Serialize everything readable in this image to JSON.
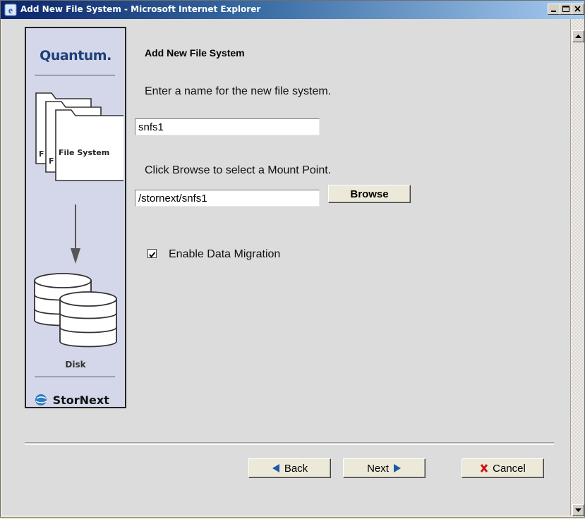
{
  "window": {
    "title": "Add New File System - Microsoft Internet Explorer"
  },
  "sidebar": {
    "brand": "Quantum.",
    "file_system_label": "File System",
    "disk_label": "Disk",
    "product": "StorNext"
  },
  "form": {
    "heading": "Add New File System",
    "name_prompt": "Enter a name for the new file system.",
    "name_value": "snfs1",
    "mount_prompt": "Click Browse to select a Mount Point.",
    "mount_value": "/stornext/snfs1",
    "browse_label": "Browse",
    "migration_label": "Enable Data Migration",
    "migration_checked": true
  },
  "footer": {
    "back_label": "Back",
    "next_label": "Next",
    "cancel_label": "Cancel"
  },
  "colors": {
    "arrow_blue": "#1f57a8",
    "cancel_red": "#cc1111",
    "brand_blue": "#1e3f7a"
  }
}
